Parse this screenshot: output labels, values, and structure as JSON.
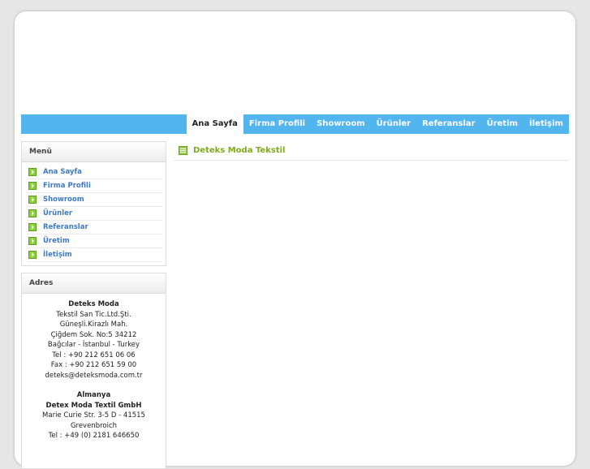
{
  "nav": {
    "items": [
      {
        "label": "Ana Sayfa",
        "active": true
      },
      {
        "label": "Firma Profili"
      },
      {
        "label": "Showroom"
      },
      {
        "label": "Ürünler"
      },
      {
        "label": "Referanslar"
      },
      {
        "label": "Üretim"
      },
      {
        "label": "İletişim"
      }
    ]
  },
  "sidebar": {
    "menu_title": "Menü",
    "menu_items": [
      {
        "label": "Ana Sayfa",
        "icon": "arrow-right-icon"
      },
      {
        "label": "Firma Profili",
        "icon": "arrow-right-icon"
      },
      {
        "label": "Showroom",
        "icon": "arrow-right-icon"
      },
      {
        "label": "Ürünler",
        "icon": "arrow-right-icon"
      },
      {
        "label": "Referanslar",
        "icon": "arrow-right-icon"
      },
      {
        "label": "Üretim",
        "icon": "arrow-right-icon"
      },
      {
        "label": "İletişim",
        "icon": "arrow-right-icon"
      }
    ],
    "address_title": "Adres",
    "address": {
      "company": "Deteks Moda",
      "lines": [
        "Tekstil San Tic.Ltd.Şti.",
        "Güneşli.Kirazlı Mah.",
        "Çiğdem Sok. No:5 34212",
        "Bağcılar - İstanbul - Turkey",
        "Tel : +90 212 651 06 06",
        "Fax : +90 212 651 59 00",
        "deteks@deteksmoda.com.tr"
      ],
      "germany_title": "Almanya",
      "germany_company": "Detex Moda Textil GmbH",
      "germany_lines": [
        "Marie Curie Str. 3-5 D - 41515",
        "Grevenbroich",
        "Tel : +49 (0) 2181 646650"
      ]
    }
  },
  "content": {
    "title": "Deteks Moda Tekstil",
    "icon": "page-icon"
  },
  "colors": {
    "nav_bg": "#53b5ee",
    "menu_link": "#3f7ac1",
    "title_green": "#7faa1c"
  }
}
